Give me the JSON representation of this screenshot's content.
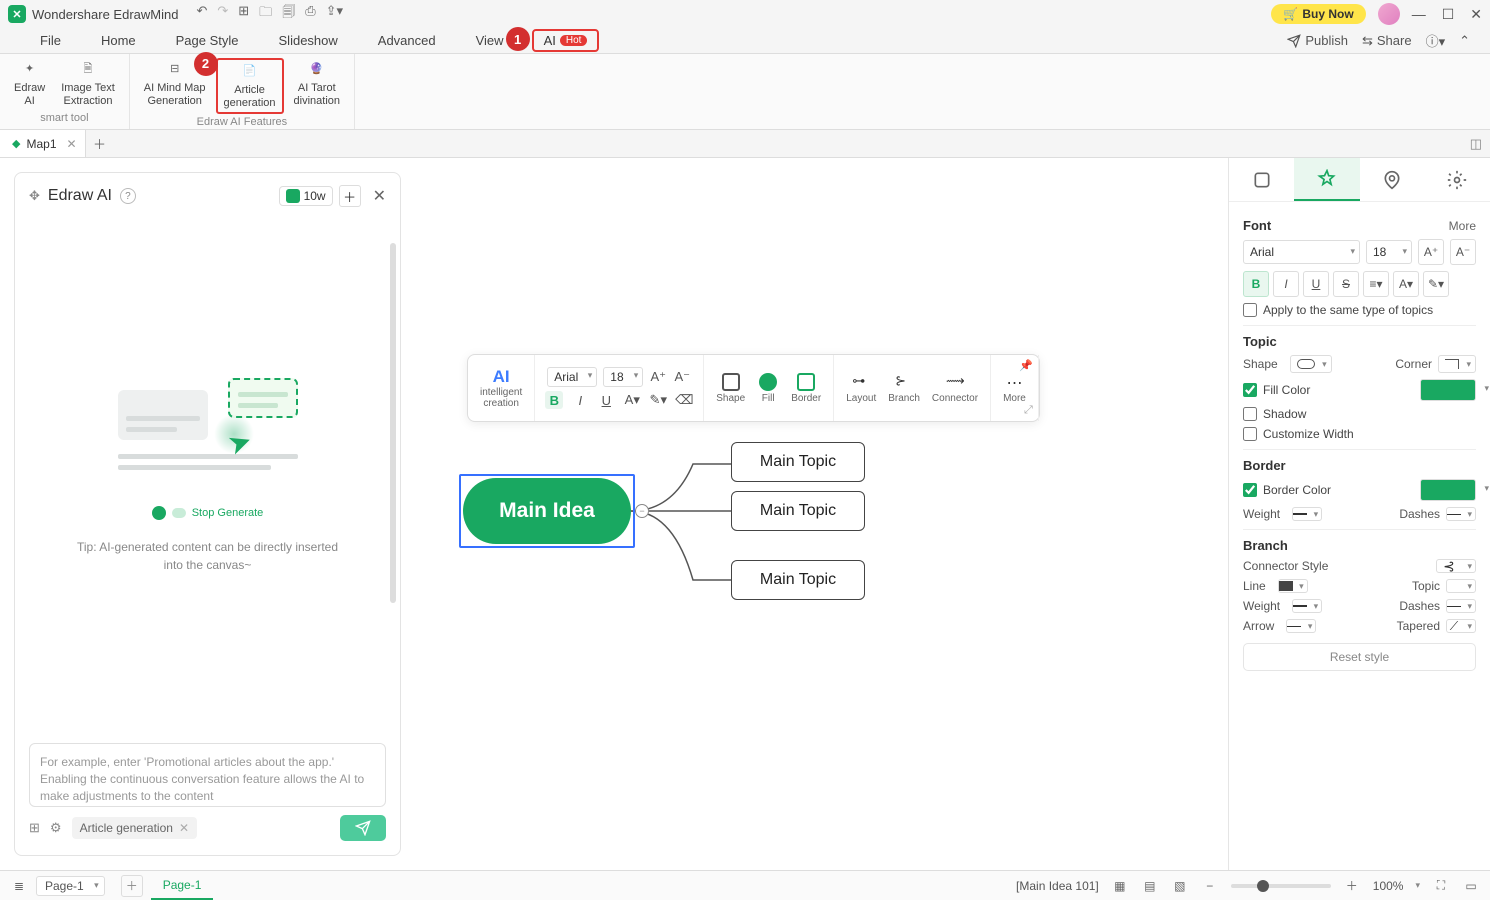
{
  "titlebar": {
    "app": "Wondershare EdrawMind",
    "buy": "Buy Now"
  },
  "menu": {
    "file": "File",
    "home": "Home",
    "pagestyle": "Page Style",
    "slideshow": "Slideshow",
    "advanced": "Advanced",
    "view": "View",
    "ai": "AI",
    "hot": "Hot",
    "publish": "Publish",
    "share": "Share"
  },
  "ribbon": {
    "g1_label": "smart tool",
    "g2_label": "Edraw AI Features",
    "edraw_ai": "Edraw\nAI",
    "image_text": "Image Text\nExtraction",
    "ai_mindmap": "AI Mind Map\nGeneration",
    "article": "Article\ngeneration",
    "tarot": "AI Tarot\ndivination"
  },
  "callouts": {
    "one": "1",
    "two": "2"
  },
  "tabs": {
    "map1": "Map1"
  },
  "ai_panel": {
    "title": "Edraw AI",
    "tokens": "10w",
    "stop": "Stop Generate",
    "tip": "Tip: AI-generated content can be directly inserted into the canvas~",
    "placeholder": "For example, enter 'Promotional articles about the app.' Enabling the continuous conversation feature allows the AI to make adjustments to the content",
    "chip": "Article generation"
  },
  "float": {
    "ai": "AI",
    "intelligent": "intelligent\ncreation",
    "font": "Arial",
    "size": "18",
    "shape": "Shape",
    "fill": "Fill",
    "border": "Border",
    "layout": "Layout",
    "branch": "Branch",
    "connector": "Connector",
    "more": "More"
  },
  "mindmap": {
    "main": "Main Idea",
    "t1": "Main Topic",
    "t2": "Main Topic",
    "t3": "Main Topic"
  },
  "right": {
    "font": "Font",
    "more": "More",
    "font_family": "Arial",
    "font_size": "18",
    "apply": "Apply to the same type of topics",
    "topic": "Topic",
    "shape": "Shape",
    "corner": "Corner",
    "fillcolor": "Fill Color",
    "shadow": "Shadow",
    "custwidth": "Customize Width",
    "border": "Border",
    "bordercolor": "Border Color",
    "weight": "Weight",
    "dashes": "Dashes",
    "branch": "Branch",
    "connstyle": "Connector Style",
    "line": "Line",
    "topic2": "Topic",
    "arrow": "Arrow",
    "tapered": "Tapered",
    "reset": "Reset style"
  },
  "status": {
    "pagesel": "Page-1",
    "pagetab": "Page-1",
    "info": "[Main Idea 101]",
    "zoom": "100%"
  }
}
